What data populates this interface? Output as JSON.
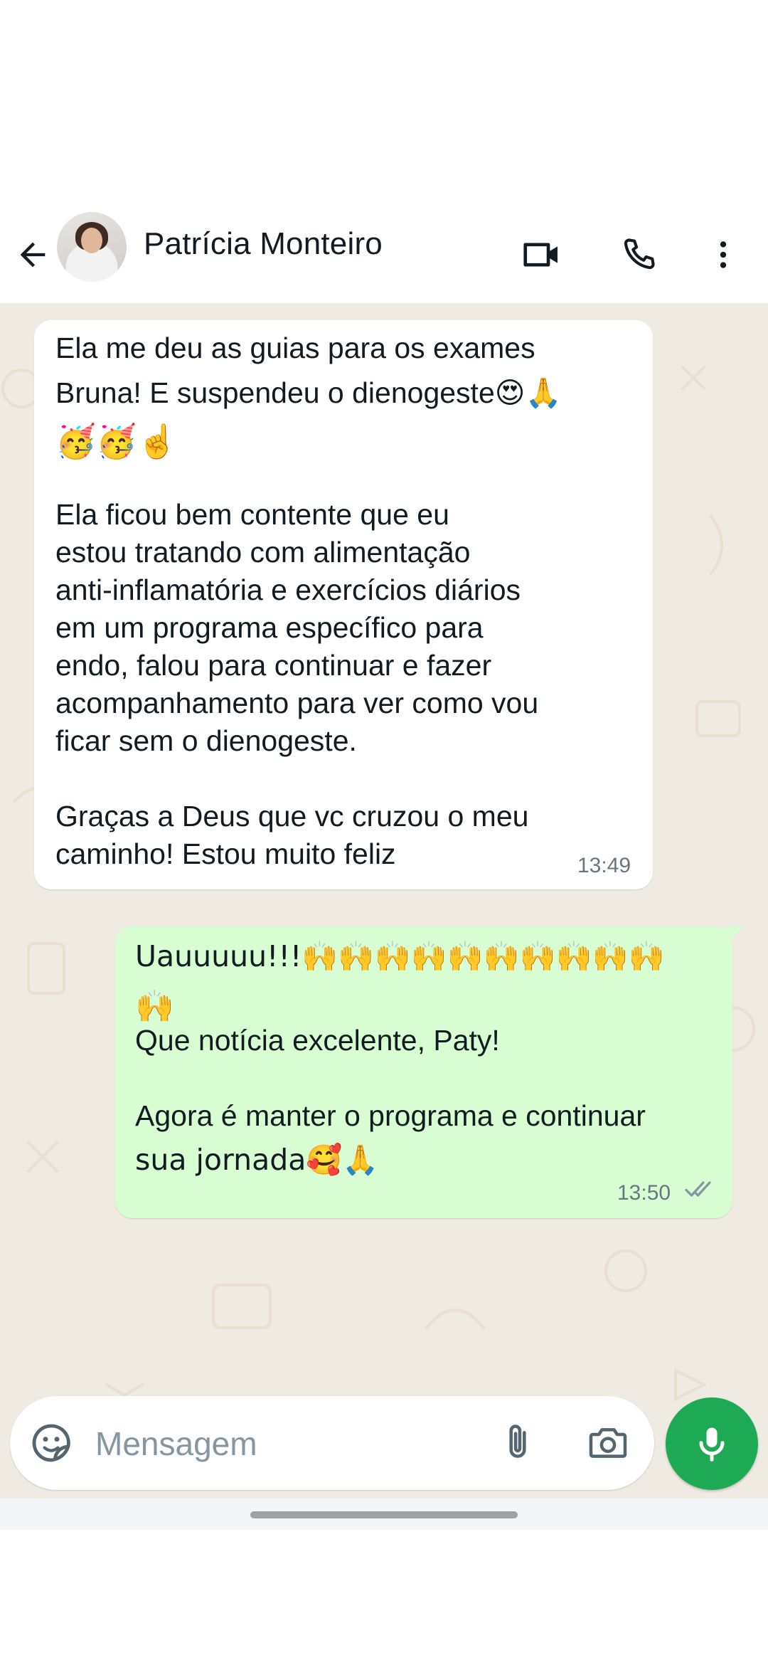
{
  "header": {
    "contact_name": "Patrícia Monteiro",
    "back_icon": "arrow-left-icon",
    "video_icon": "video-call-icon",
    "call_icon": "phone-icon",
    "menu_icon": "more-vertical-icon"
  },
  "messages": [
    {
      "direction": "incoming",
      "lines": [
        "Ela me deu as guias para os exames",
        "Bruna! E suspendeu o dienogeste😍🙏",
        "🥳🥳☝️",
        "",
        "Ela ficou bem contente que eu",
        "estou tratando com alimentação",
        "anti-inflamatória e exercícios diários",
        "em um programa específico para",
        "endo, falou para continuar e fazer",
        "acompanhamento para ver como vou",
        "ficar sem o dienogeste.",
        "",
        "Graças a Deus que vc cruzou o meu",
        "caminho! Estou muito feliz"
      ],
      "time": "13:49"
    },
    {
      "direction": "outgoing",
      "lines": [
        "Uauuuuu!!!🙌🙌🙌🙌🙌🙌🙌🙌🙌🙌",
        "🙌",
        "",
        "Que notícia excelente, Paty!",
        "",
        "Agora é manter o programa e continuar",
        "sua jornada🥰🙏"
      ],
      "time": "13:50",
      "status": "read"
    }
  ],
  "composer": {
    "placeholder": "Mensagem",
    "emoji_icon": "sticker-icon",
    "attach_icon": "paperclip-icon",
    "camera_icon": "camera-icon",
    "mic_icon": "microphone-icon"
  },
  "colors": {
    "chat_background": "#efeae2",
    "incoming_bubble": "#ffffff",
    "outgoing_bubble": "#d9fdd3",
    "accent_green": "#1ea955"
  }
}
